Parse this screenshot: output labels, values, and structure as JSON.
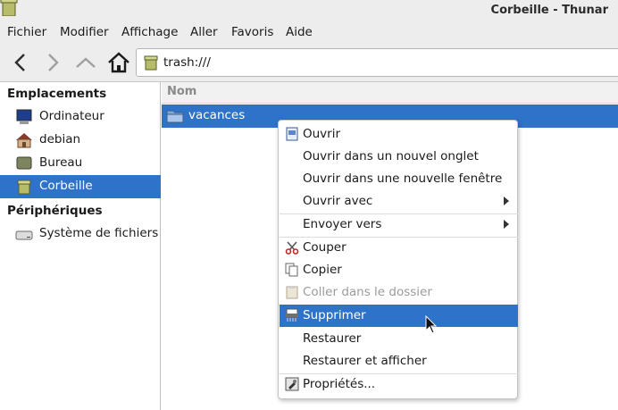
{
  "window": {
    "title": "Corbeille - Thunar"
  },
  "menubar": {
    "items": [
      "Fichier",
      "Modifier",
      "Affichage",
      "Aller",
      "Favoris",
      "Aide"
    ]
  },
  "toolbar": {
    "back_icon": "chevron-left-icon",
    "forward_icon": "chevron-right-icon",
    "up_icon": "chevron-up-icon",
    "home_icon": "home-icon",
    "location": "trash:///"
  },
  "sidebar": {
    "sections": [
      {
        "header": "Emplacements",
        "items": [
          {
            "label": "Ordinateur",
            "icon": "computer-icon"
          },
          {
            "label": "debian",
            "icon": "user-home-icon"
          },
          {
            "label": "Bureau",
            "icon": "desktop-icon"
          },
          {
            "label": "Corbeille",
            "icon": "trash-icon",
            "selected": true
          }
        ]
      },
      {
        "header": "Périphériques",
        "items": [
          {
            "label": "Système de fichiers",
            "icon": "drive-icon"
          }
        ]
      }
    ]
  },
  "main": {
    "column_header": "Nom",
    "files": [
      {
        "name": "vacances",
        "icon": "folder-icon",
        "selected": true
      }
    ]
  },
  "context_menu": {
    "items": [
      {
        "label": "Ouvrir",
        "icon": "open-icon"
      },
      {
        "label": "Ouvrir dans un nouvel onglet"
      },
      {
        "label": "Ouvrir dans une nouvelle fenêtre"
      },
      {
        "label": "Ouvrir avec",
        "submenu": true
      },
      {
        "label": "Envoyer vers",
        "submenu": true
      },
      {
        "label": "Couper",
        "icon": "scissors-icon"
      },
      {
        "label": "Copier",
        "icon": "copy-icon"
      },
      {
        "label": "Coller dans le dossier",
        "icon": "paste-icon",
        "disabled": true
      },
      {
        "label": "Supprimer",
        "icon": "shredder-icon",
        "highlighted": true
      },
      {
        "label": "Restaurer"
      },
      {
        "label": "Restaurer et afficher"
      },
      {
        "label": "Propriétés...",
        "icon": "properties-icon"
      }
    ]
  },
  "colors": {
    "selection": "#2f72c9",
    "chrome": "#ededed"
  }
}
